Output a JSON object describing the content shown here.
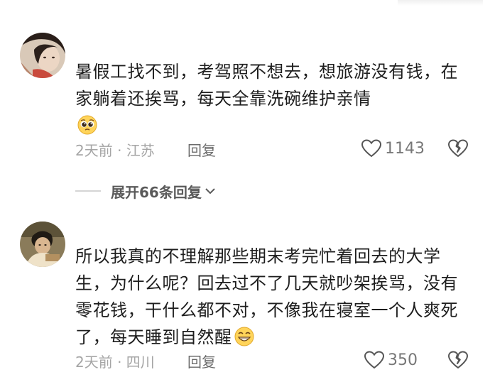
{
  "comments": [
    {
      "text": "暑假工找不到，考驾照不想去，想旅游没有钱，在家躺着还挨骂，每天全靠洗碗维护亲情",
      "emoji": "pleading-face",
      "time": "2天前",
      "location": "江苏",
      "time_location": "2天前 · 江苏",
      "reply_label": "回复",
      "likes": "1143"
    },
    {
      "text": "所以我真的不理解那些期末考完忙着回去的大学生，为什么呢？回去过不了几天就吵架挨骂，没有零花钱，干什么都不对，不像我在寝室一个人爽死了，每天睡到自然醒",
      "emoji": "grinning-face",
      "time": "2天前",
      "location": "四川",
      "time_location": "2天前 · 四川",
      "reply_label": "回复",
      "likes": "350"
    }
  ],
  "expand": {
    "label": "展开66条回复"
  },
  "icons": {
    "like": "heart-outline-icon",
    "dislike": "broken-heart-icon",
    "expand": "chevron-down-icon"
  },
  "colors": {
    "text": "#1e1e1e",
    "meta": "#a5a5a5",
    "icon": "#555555"
  }
}
